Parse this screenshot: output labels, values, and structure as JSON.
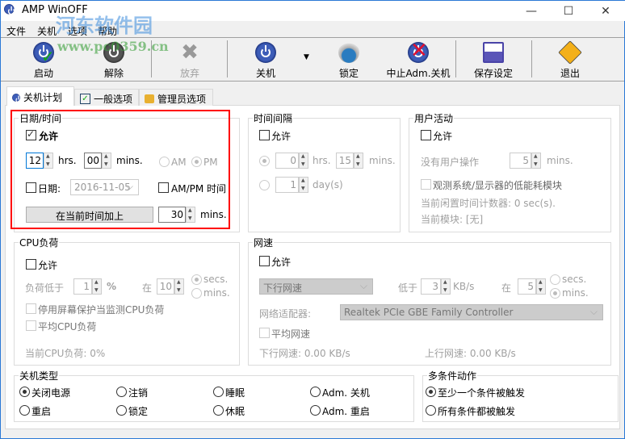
{
  "window": {
    "title": "AMP WinOFF",
    "minimize": "—",
    "maximize": "☐",
    "close": "✕"
  },
  "watermark": {
    "name": "河东软件园",
    "url": "www.pc0359.cn"
  },
  "menu": [
    "文件",
    "关机",
    "选项",
    "帮助"
  ],
  "toolbar": {
    "start": "启动",
    "release": "解除",
    "abandon": "放弃",
    "shutdown": "关机",
    "lock": "锁定",
    "abort_adm": "中止Adm.关机",
    "save": "保存设定",
    "exit": "退出"
  },
  "tabs": [
    "关机计划",
    "一般选项",
    "管理员选项"
  ],
  "datetime": {
    "title": "日期/时间",
    "allow": "允许",
    "allow_checked": true,
    "hours": "12",
    "hrs": "hrs.",
    "minutes": "00",
    "mins": "mins.",
    "am": "AM",
    "pm": "PM",
    "pm_selected": true,
    "date_label": "日期:",
    "date_value": "2016-11-05",
    "ampm_time": "AM/PM 时间",
    "add_button": "在当前时间加上",
    "add_value": "30",
    "add_unit": "mins."
  },
  "interval": {
    "title": "时间间隔",
    "allow": "允许",
    "hours": "0",
    "hrs": "hrs.",
    "minutes": "15",
    "mins": "mins.",
    "days": "1",
    "days_unit": "day(s)"
  },
  "user_activity": {
    "title": "用户活动",
    "allow": "允许",
    "no_action": "没有用户操作",
    "minutes": "5",
    "mins": "mins.",
    "observe": "观测系统/显示器的低能耗模块",
    "idle_counter": "当前闲置时间计数器: 0 sec(s).",
    "current_module": "当前模块: [无]"
  },
  "cpu": {
    "title": "CPU负荷",
    "allow": "允许",
    "below": "负荷低于",
    "percent_value": "1",
    "percent": "%",
    "at": "在",
    "duration": "10",
    "secs": "secs.",
    "mins": "mins.",
    "secs_selected": true,
    "disable_screensaver": "停用屏幕保护当监测CPU负荷",
    "average": "平均CPU负荷",
    "current": "当前CPU负荷: 0%"
  },
  "network": {
    "title": "网速",
    "allow": "允许",
    "direction": "下行网速",
    "below": "低于",
    "speed": "3",
    "speed_unit": "KB/s",
    "at": "在",
    "duration": "5",
    "secs": "secs.",
    "mins": "mins.",
    "mins_selected": true,
    "adapter_label": "网络适配器:",
    "adapter": "Realtek PCIe GBE Family Controller",
    "average": "平均网速",
    "down": "下行网速: 0.00 KB/s",
    "up": "上行网速: 0.00 KB/s"
  },
  "shutdown_type": {
    "title": "关机类型",
    "options": [
      "关闭电源",
      "注销",
      "睡眠",
      "Adm. 关机",
      "重启",
      "锁定",
      "休眠",
      "Adm. 重启"
    ],
    "selected": 0
  },
  "multi": {
    "title": "多条件动作",
    "options": [
      "至少一个条件被触发",
      "所有条件都被触发"
    ],
    "selected": 0
  }
}
